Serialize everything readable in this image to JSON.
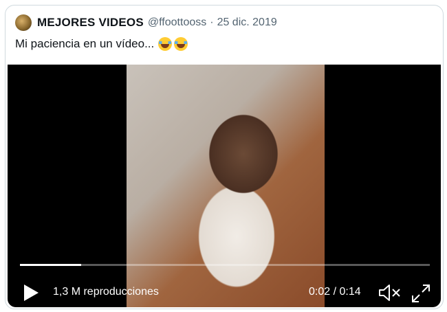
{
  "tweet": {
    "author_name": "MEJORES VIDEOS",
    "handle": "@ffoottooss",
    "separator": "·",
    "date": "25 dic. 2019",
    "text": "Mi paciencia en un vídeo..."
  },
  "video": {
    "views": "1,3 M reproducciones",
    "time": "0:02 / 0:14",
    "progress": 0.15
  },
  "icons": {
    "avatar": "avatar-image",
    "emoji": "face-with-tears-of-joy-icon",
    "play": "play-icon",
    "mute": "volume-muted-icon",
    "fullscreen": "fullscreen-icon"
  }
}
